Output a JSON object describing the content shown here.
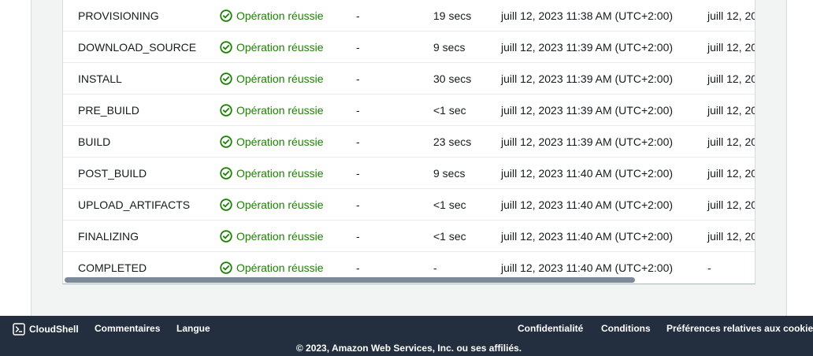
{
  "status_color": "#1d8102",
  "phases": [
    {
      "phase": "PROVISIONING",
      "status": "Opération réussie",
      "context": "-",
      "duration": "19 secs",
      "start": "juill 12, 2023 11:38 AM (UTC+2:00)",
      "end": "juill 12, 20"
    },
    {
      "phase": "DOWNLOAD_SOURCE",
      "status": "Opération réussie",
      "context": "-",
      "duration": "9 secs",
      "start": "juill 12, 2023 11:39 AM (UTC+2:00)",
      "end": "juill 12, 20"
    },
    {
      "phase": "INSTALL",
      "status": "Opération réussie",
      "context": "-",
      "duration": "30 secs",
      "start": "juill 12, 2023 11:39 AM (UTC+2:00)",
      "end": "juill 12, 20"
    },
    {
      "phase": "PRE_BUILD",
      "status": "Opération réussie",
      "context": "-",
      "duration": "<1 sec",
      "start": "juill 12, 2023 11:39 AM (UTC+2:00)",
      "end": "juill 12, 20"
    },
    {
      "phase": "BUILD",
      "status": "Opération réussie",
      "context": "-",
      "duration": "23 secs",
      "start": "juill 12, 2023 11:39 AM (UTC+2:00)",
      "end": "juill 12, 20"
    },
    {
      "phase": "POST_BUILD",
      "status": "Opération réussie",
      "context": "-",
      "duration": "9 secs",
      "start": "juill 12, 2023 11:40 AM (UTC+2:00)",
      "end": "juill 12, 20"
    },
    {
      "phase": "UPLOAD_ARTIFACTS",
      "status": "Opération réussie",
      "context": "-",
      "duration": "<1 sec",
      "start": "juill 12, 2023 11:40 AM (UTC+2:00)",
      "end": "juill 12, 20"
    },
    {
      "phase": "FINALIZING",
      "status": "Opération réussie",
      "context": "-",
      "duration": "<1 sec",
      "start": "juill 12, 2023 11:40 AM (UTC+2:00)",
      "end": "juill 12, 20"
    },
    {
      "phase": "COMPLETED",
      "status": "Opération réussie",
      "context": "-",
      "duration": "-",
      "start": "juill 12, 2023 11:40 AM (UTC+2:00)",
      "end": "-"
    }
  ],
  "footer": {
    "cloudshell": "CloudShell",
    "feedback": "Commentaires",
    "language": "Langue",
    "privacy": "Confidentialité",
    "terms": "Conditions",
    "cookies": "Préférences relatives aux cookies",
    "copyright": "© 2023, Amazon Web Services, Inc. ou ses affiliés."
  }
}
